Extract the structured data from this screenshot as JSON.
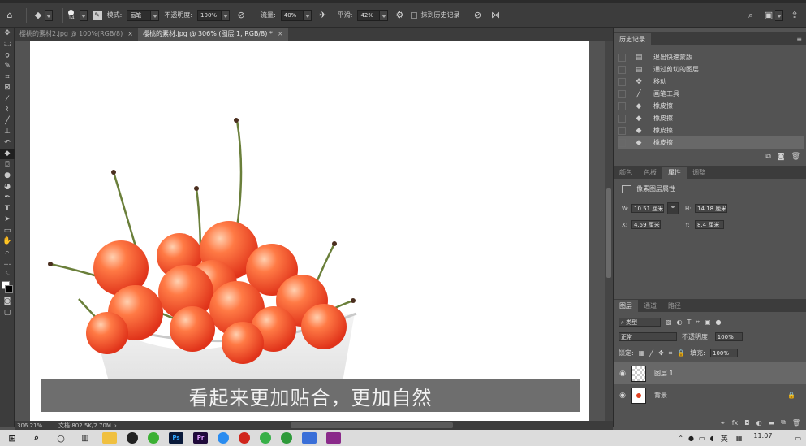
{
  "options_bar": {
    "brush_size": "14",
    "mode_label": "模式:",
    "mode_value": "画笔",
    "opacity_label": "不透明度:",
    "opacity_value": "100%",
    "flow_label": "流量:",
    "flow_value": "40%",
    "smoothing_label": "平滑:",
    "smoothing_value": "42%",
    "erase_history_label": "抹到历史记录"
  },
  "document_tabs": [
    {
      "label": "樱桃的素材2.jpg @ 100%(RGB/8)",
      "close": "×"
    },
    {
      "label": "樱桃的素材.jpg @ 306% (图层 1, RGB/8) *",
      "close": "×"
    }
  ],
  "subtitle": "看起来更加贴合，更加自然",
  "status": {
    "zoom": "306.21%",
    "doc_info": "文档:802.5K/2.70M"
  },
  "history": {
    "title": "历史记录",
    "items": [
      {
        "label": "退出快速蒙版",
        "icon": "document-icon"
      },
      {
        "label": "通过剪切的图层",
        "icon": "document-icon"
      },
      {
        "label": "移动",
        "icon": "move-icon"
      },
      {
        "label": "画笔工具",
        "icon": "brush-icon"
      },
      {
        "label": "橡皮擦",
        "icon": "eraser-icon"
      },
      {
        "label": "橡皮擦",
        "icon": "eraser-icon"
      },
      {
        "label": "橡皮擦",
        "icon": "eraser-icon"
      },
      {
        "label": "橡皮擦",
        "icon": "eraser-icon"
      }
    ]
  },
  "properties": {
    "tabs": [
      "颜色",
      "色板",
      "属性",
      "调整"
    ],
    "active_tab": "属性",
    "section_title": "像素图层属性",
    "w_label": "W:",
    "w_value": "10.51 厘米",
    "h_label": "H:",
    "h_value": "14.18 厘米",
    "x_label": "X:",
    "x_value": "4.59 厘米",
    "y_label": "Y:",
    "y_value": "8.4 厘米"
  },
  "layers": {
    "tabs": [
      "图层",
      "通道",
      "路径"
    ],
    "kind_filter": "类型",
    "blend_mode": "正常",
    "opacity_label": "不透明度:",
    "opacity_value": "100%",
    "lock_label": "锁定:",
    "fill_label": "填充:",
    "fill_value": "100%",
    "items": [
      {
        "name": "图层 1"
      },
      {
        "name": "背景"
      }
    ]
  },
  "taskbar": {
    "ime": "英",
    "time": "11:07"
  }
}
